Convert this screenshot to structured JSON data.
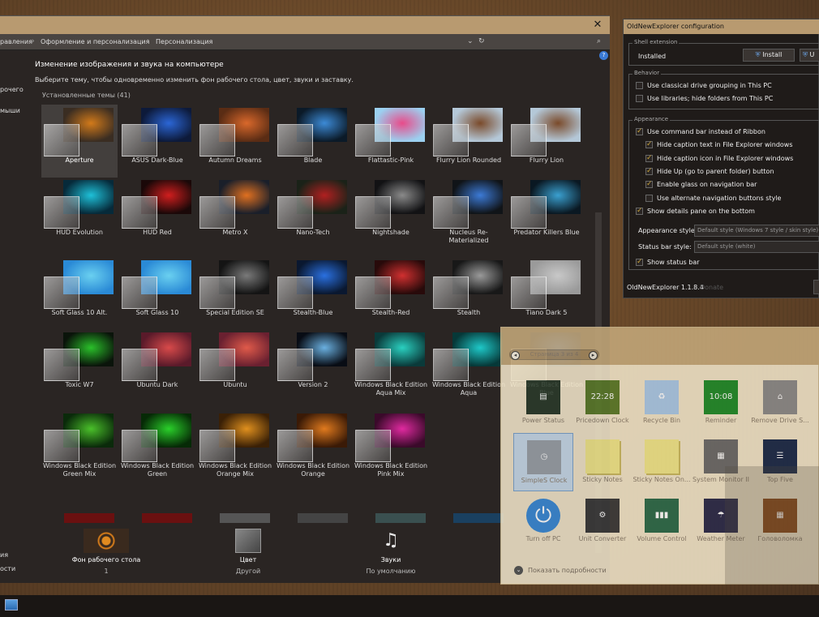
{
  "main_window": {
    "close_glyph": "✕",
    "breadcrumb": [
      "равления",
      "Оформление и персонализация",
      "Персонализация"
    ],
    "sidebar_labels": [
      "рочего",
      "мыши",
      "ия",
      "ости"
    ],
    "heading": "Изменение изображения и звука на компьютере",
    "subheading": "Выберите тему, чтобы одновременно изменить фон рабочего стола, цвет, звуки и заставку.",
    "group_label": "Установленные темы (41)",
    "themes": [
      {
        "name": "Aperture",
        "selected": true,
        "bg": "#3a2d22",
        "accent": "#d27a1a"
      },
      {
        "name": "ASUS Dark-Blue",
        "bg": "#0d1a3a",
        "accent": "#2b66d6"
      },
      {
        "name": "Autumn Dreams",
        "bg": "#5a2c14",
        "accent": "#d9682b"
      },
      {
        "name": "Blade",
        "bg": "#0b1a28",
        "accent": "#3c8ad6"
      },
      {
        "name": "Flattastic-Pink",
        "bg": "#9bd0f0",
        "accent": "#e84b8a"
      },
      {
        "name": "Flurry Lion Rounded",
        "bg": "#b4c8d8",
        "accent": "#7a4a2a"
      },
      {
        "name": "Flurry Lion",
        "bg": "#b4c8d8",
        "accent": "#7a4a2a"
      },
      {
        "name": "HUD Evolution",
        "bg": "#062a3a",
        "accent": "#1ec0d8"
      },
      {
        "name": "HUD Red",
        "bg": "#1a0808",
        "accent": "#d01e1e"
      },
      {
        "name": "Metro X",
        "bg": "#1a1f2a",
        "accent": "#e07020"
      },
      {
        "name": "Nano-Tech",
        "bg": "#1a2218",
        "accent": "#b02020"
      },
      {
        "name": "Nightshade",
        "bg": "#121214",
        "accent": "#8a8a8a"
      },
      {
        "name": "Nucleus Re-Materialized",
        "bg": "#101418",
        "accent": "#3c7ad6"
      },
      {
        "name": "Predator Killers Blue",
        "bg": "#0a1822",
        "accent": "#3aa0d0"
      },
      {
        "name": "Soft Glass 10  Alt.",
        "bg": "#2a8ad6",
        "accent": "#6ad0f0"
      },
      {
        "name": "Soft Glass 10",
        "bg": "#2a8ad6",
        "accent": "#6ad0f0"
      },
      {
        "name": "Special Edition SE",
        "bg": "#141414",
        "accent": "#7a7a7a"
      },
      {
        "name": "Stealth-Blue",
        "bg": "#0a1830",
        "accent": "#2a70e0"
      },
      {
        "name": "Stealth-Red",
        "bg": "#280a0a",
        "accent": "#d03030"
      },
      {
        "name": "Stealth",
        "bg": "#181818",
        "accent": "#9a9a9a"
      },
      {
        "name": "Tiano Dark 5",
        "bg": "#9a9a9a",
        "accent": "#c8c8c8"
      },
      {
        "name": "Toxic W7",
        "bg": "#0a140a",
        "accent": "#2ac02a"
      },
      {
        "name": "Ubuntu Dark",
        "bg": "#5a1a2a",
        "accent": "#d84a4a"
      },
      {
        "name": "Ubuntu",
        "bg": "#6a2030",
        "accent": "#e05a4a"
      },
      {
        "name": "Version 2",
        "bg": "#080c14",
        "accent": "#6ab0e0"
      },
      {
        "name": "Windows Black Edition Aqua Mix",
        "bg": "#0a3a3a",
        "accent": "#2ad0c0"
      },
      {
        "name": "Windows Black Edition Aqua",
        "bg": "#063838",
        "accent": "#1ec8c8"
      },
      {
        "name": "Windows Black Edition Blue",
        "bg": "#061a3a",
        "accent": "#1e6ae0"
      },
      {
        "name": "Windows Black Edition Green Mix",
        "bg": "#0a2a0a",
        "accent": "#4ac02a"
      },
      {
        "name": "Windows Black Edition Green",
        "bg": "#062a06",
        "accent": "#2ad02a"
      },
      {
        "name": "Windows Black Edition Orange Mix",
        "bg": "#3a2006",
        "accent": "#e0901e"
      },
      {
        "name": "Windows Black Edition Orange",
        "bg": "#3a1a06",
        "accent": "#e07a1e"
      },
      {
        "name": "Windows Black Edition Pink Mix",
        "bg": "#3a0a2a",
        "accent": "#e02aa0"
      }
    ],
    "partial_row_colors": [
      "#6a1010",
      "#6a1010",
      "#555",
      "#444",
      "#3a5050",
      "#1a4060"
    ],
    "bottom": [
      {
        "label": "Фон рабочего стола",
        "sub": "1"
      },
      {
        "label": "Цвет",
        "sub": "Другой"
      },
      {
        "label": "Звуки",
        "sub": "По умолчанию"
      }
    ]
  },
  "config": {
    "title": "OldNewExplorer configuration",
    "shell_extension": {
      "label": "Shell extension",
      "status": "Installed",
      "install_btn": "Install",
      "uninstall_btn": "U"
    },
    "behavior": {
      "label": "Behavior",
      "items": [
        {
          "text": "Use classical drive grouping in This PC",
          "checked": false
        },
        {
          "text": "Use libraries; hide folders from This PC",
          "checked": false
        }
      ]
    },
    "appearance": {
      "label": "Appearance",
      "items": [
        {
          "text": "Use command bar instead of Ribbon",
          "checked": true,
          "indent": 0
        },
        {
          "text": "Hide caption text in File Explorer windows",
          "checked": true,
          "indent": 1
        },
        {
          "text": "Hide caption icon in File Explorer windows",
          "checked": true,
          "indent": 1
        },
        {
          "text": "Hide Up (go to parent folder) button",
          "checked": true,
          "indent": 1
        },
        {
          "text": "Enable glass on navigation bar",
          "checked": true,
          "indent": 1
        },
        {
          "text": "Use alternate navigation buttons style",
          "checked": false,
          "indent": 1
        },
        {
          "text": "Show details pane on the bottom",
          "checked": true,
          "indent": 0
        }
      ],
      "appearance_style_label": "Appearance style:",
      "appearance_style_value": "Default style (Windows 7 style / skin style)",
      "statusbar_style_label": "Status bar style:",
      "statusbar_style_value": "Default style (white)",
      "show_statusbar": "Show status bar"
    },
    "version": "OldNewExplorer 1.1.8.4",
    "version_link": "Donate"
  },
  "gadgets": {
    "page_text": "Страница 3 из 4",
    "items": [
      {
        "name": "Power Status",
        "icon": "power-status",
        "color": "#2a3a2a"
      },
      {
        "name": "Pricedown Clock",
        "icon": "digital-clock",
        "color": "#5a7a2a"
      },
      {
        "name": "Recycle Bin",
        "icon": "recycle-bin",
        "color": "#a8c8e8"
      },
      {
        "name": "Reminder",
        "icon": "reminder",
        "color": "#1e8a2a"
      },
      {
        "name": "Remove Drive S...",
        "icon": "usb-drive",
        "color": "#8a8a8a"
      },
      {
        "name": "SimpleS Clock",
        "icon": "analog-clock",
        "color": "#9aa0a8",
        "selected": true
      },
      {
        "name": "Sticky Notes",
        "icon": "sticky-note",
        "color": "#f0e68a"
      },
      {
        "name": "Sticky Notes On...",
        "icon": "sticky-note",
        "color": "#f0e68a"
      },
      {
        "name": "System Monitor II",
        "icon": "cpu-chip",
        "color": "#6a6a6a"
      },
      {
        "name": "Top Five",
        "icon": "process-list",
        "color": "#1a2a4a"
      },
      {
        "name": "Turn off PC",
        "icon": "power-button",
        "color": "#3a8ad6"
      },
      {
        "name": "Unit Converter",
        "icon": "unit-converter",
        "color": "#3a3a3a"
      },
      {
        "name": "Volume Control",
        "icon": "volume-bar",
        "color": "#2a6a4a"
      },
      {
        "name": "Weather Meter",
        "icon": "weather-meter",
        "color": "#2a2a4a"
      },
      {
        "name": "Головоломка",
        "icon": "puzzle",
        "color": "#8a4a1a"
      }
    ],
    "details": "Показать подробности"
  }
}
